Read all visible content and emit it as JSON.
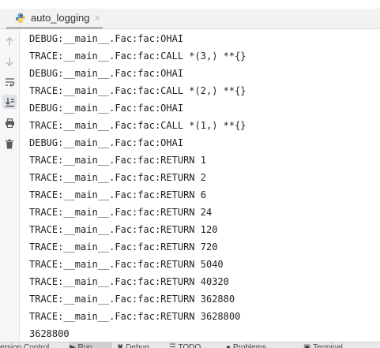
{
  "tab": {
    "title": "auto_logging",
    "close_glyph": "×",
    "icon": "python-icon"
  },
  "gutter": {
    "buttons": [
      {
        "name": "scroll-up-icon",
        "active": false
      },
      {
        "name": "scroll-down-icon",
        "active": false
      },
      {
        "name": "soft-wrap-icon",
        "active": false
      },
      {
        "name": "scroll-to-end-icon",
        "active": true
      },
      {
        "name": "print-icon",
        "active": false
      },
      {
        "name": "trash-icon",
        "active": false
      }
    ]
  },
  "console": {
    "lines": [
      "DEBUG:__main__.Fac:fac:OHAI",
      "TRACE:__main__.Fac:fac:CALL *(3,) **{}",
      "DEBUG:__main__.Fac:fac:OHAI",
      "TRACE:__main__.Fac:fac:CALL *(2,) **{}",
      "DEBUG:__main__.Fac:fac:OHAI",
      "TRACE:__main__.Fac:fac:CALL *(1,) **{}",
      "DEBUG:__main__.Fac:fac:OHAI",
      "TRACE:__main__.Fac:fac:RETURN 1",
      "TRACE:__main__.Fac:fac:RETURN 2",
      "TRACE:__main__.Fac:fac:RETURN 6",
      "TRACE:__main__.Fac:fac:RETURN 24",
      "TRACE:__main__.Fac:fac:RETURN 120",
      "TRACE:__main__.Fac:fac:RETURN 720",
      "TRACE:__main__.Fac:fac:RETURN 5040",
      "TRACE:__main__.Fac:fac:RETURN 40320",
      "TRACE:__main__.Fac:fac:RETURN 362880",
      "TRACE:__main__.Fac:fac:RETURN 3628800",
      "3628800"
    ]
  },
  "bottom_tabs": [
    {
      "label": "ersion Control",
      "selected": false
    },
    {
      "label": "▶ Run",
      "selected": true
    },
    {
      "label": "✖ Debug",
      "selected": false
    },
    {
      "label": "☰ TODO",
      "selected": false
    },
    {
      "label": "● Problems",
      "selected": false
    },
    {
      "label": "▣ Terminal",
      "selected": false
    }
  ],
  "colors": {
    "accent": "#3d6eb4",
    "python_blue": "#3d7ab3",
    "python_yellow": "#f2c94c"
  }
}
